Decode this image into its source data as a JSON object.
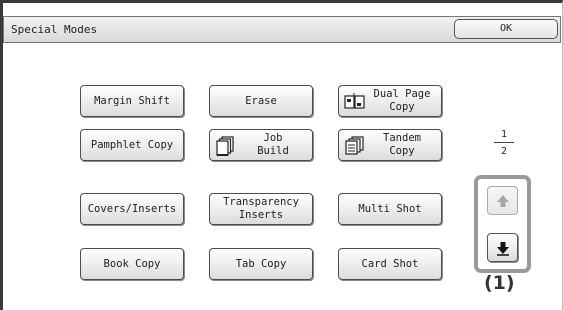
{
  "window": {
    "title": "Special Modes",
    "ok_label": "OK"
  },
  "modes": {
    "margin_shift": "Margin Shift",
    "erase": "Erase",
    "dual_page_copy": "Dual Page\nCopy",
    "pamphlet_copy": "Pamphlet Copy",
    "job_build": "Job\nBuild",
    "tandem_copy": "Tandem\nCopy",
    "covers_inserts": "Covers/Inserts",
    "transparency_inserts": "Transparency\nInserts",
    "multi_shot": "Multi Shot",
    "book_copy": "Book Copy",
    "tab_copy": "Tab Copy",
    "card_shot": "Card Shot"
  },
  "pager": {
    "current": "1",
    "total": "2",
    "up_enabled": false
  },
  "callout": "(1)",
  "icons": {
    "dual_page_copy": "dual-page-copy-icon",
    "job_build": "job-build-icon",
    "tandem_copy": "tandem-copy-icon",
    "up": "arrow-up-icon",
    "down": "arrow-down-icon"
  }
}
